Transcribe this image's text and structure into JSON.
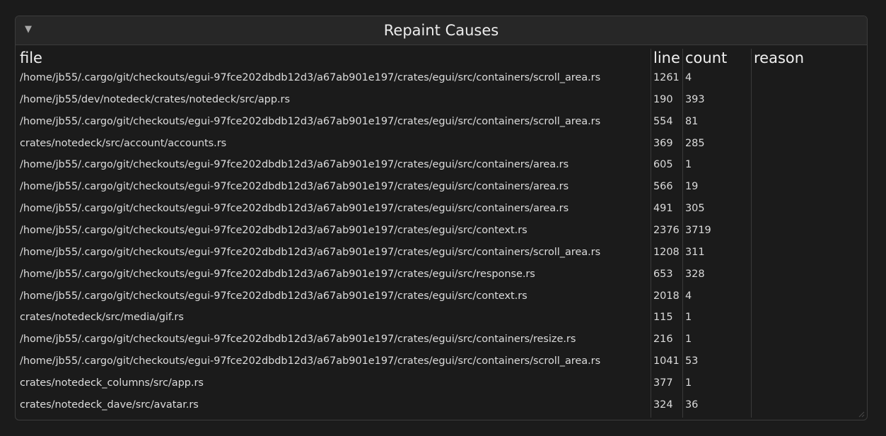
{
  "window": {
    "title": "Repaint Causes",
    "collapse_icon": "▼"
  },
  "table": {
    "columns": [
      "file",
      "line",
      "count",
      "reason"
    ],
    "rows": [
      {
        "file": "/home/jb55/.cargo/git/checkouts/egui-97fce202dbdb12d3/a67ab901e197/crates/egui/src/containers/scroll_area.rs",
        "line": "1261",
        "count": "4",
        "reason": ""
      },
      {
        "file": "/home/jb55/dev/notedeck/crates/notedeck/src/app.rs",
        "line": "190",
        "count": "393",
        "reason": ""
      },
      {
        "file": "/home/jb55/.cargo/git/checkouts/egui-97fce202dbdb12d3/a67ab901e197/crates/egui/src/containers/scroll_area.rs",
        "line": "554",
        "count": "81",
        "reason": ""
      },
      {
        "file": "crates/notedeck/src/account/accounts.rs",
        "line": "369",
        "count": "285",
        "reason": ""
      },
      {
        "file": "/home/jb55/.cargo/git/checkouts/egui-97fce202dbdb12d3/a67ab901e197/crates/egui/src/containers/area.rs",
        "line": "605",
        "count": "1",
        "reason": ""
      },
      {
        "file": "/home/jb55/.cargo/git/checkouts/egui-97fce202dbdb12d3/a67ab901e197/crates/egui/src/containers/area.rs",
        "line": "566",
        "count": "19",
        "reason": ""
      },
      {
        "file": "/home/jb55/.cargo/git/checkouts/egui-97fce202dbdb12d3/a67ab901e197/crates/egui/src/containers/area.rs",
        "line": "491",
        "count": "305",
        "reason": ""
      },
      {
        "file": "/home/jb55/.cargo/git/checkouts/egui-97fce202dbdb12d3/a67ab901e197/crates/egui/src/context.rs",
        "line": "2376",
        "count": "3719",
        "reason": ""
      },
      {
        "file": "/home/jb55/.cargo/git/checkouts/egui-97fce202dbdb12d3/a67ab901e197/crates/egui/src/containers/scroll_area.rs",
        "line": "1208",
        "count": "311",
        "reason": ""
      },
      {
        "file": "/home/jb55/.cargo/git/checkouts/egui-97fce202dbdb12d3/a67ab901e197/crates/egui/src/response.rs",
        "line": "653",
        "count": "328",
        "reason": ""
      },
      {
        "file": "/home/jb55/.cargo/git/checkouts/egui-97fce202dbdb12d3/a67ab901e197/crates/egui/src/context.rs",
        "line": "2018",
        "count": "4",
        "reason": ""
      },
      {
        "file": "crates/notedeck/src/media/gif.rs",
        "line": "115",
        "count": "1",
        "reason": ""
      },
      {
        "file": "/home/jb55/.cargo/git/checkouts/egui-97fce202dbdb12d3/a67ab901e197/crates/egui/src/containers/resize.rs",
        "line": "216",
        "count": "1",
        "reason": ""
      },
      {
        "file": "/home/jb55/.cargo/git/checkouts/egui-97fce202dbdb12d3/a67ab901e197/crates/egui/src/containers/scroll_area.rs",
        "line": "1041",
        "count": "53",
        "reason": ""
      },
      {
        "file": "crates/notedeck_columns/src/app.rs",
        "line": "377",
        "count": "1",
        "reason": ""
      },
      {
        "file": "crates/notedeck_dave/src/avatar.rs",
        "line": "324",
        "count": "36",
        "reason": ""
      }
    ]
  }
}
